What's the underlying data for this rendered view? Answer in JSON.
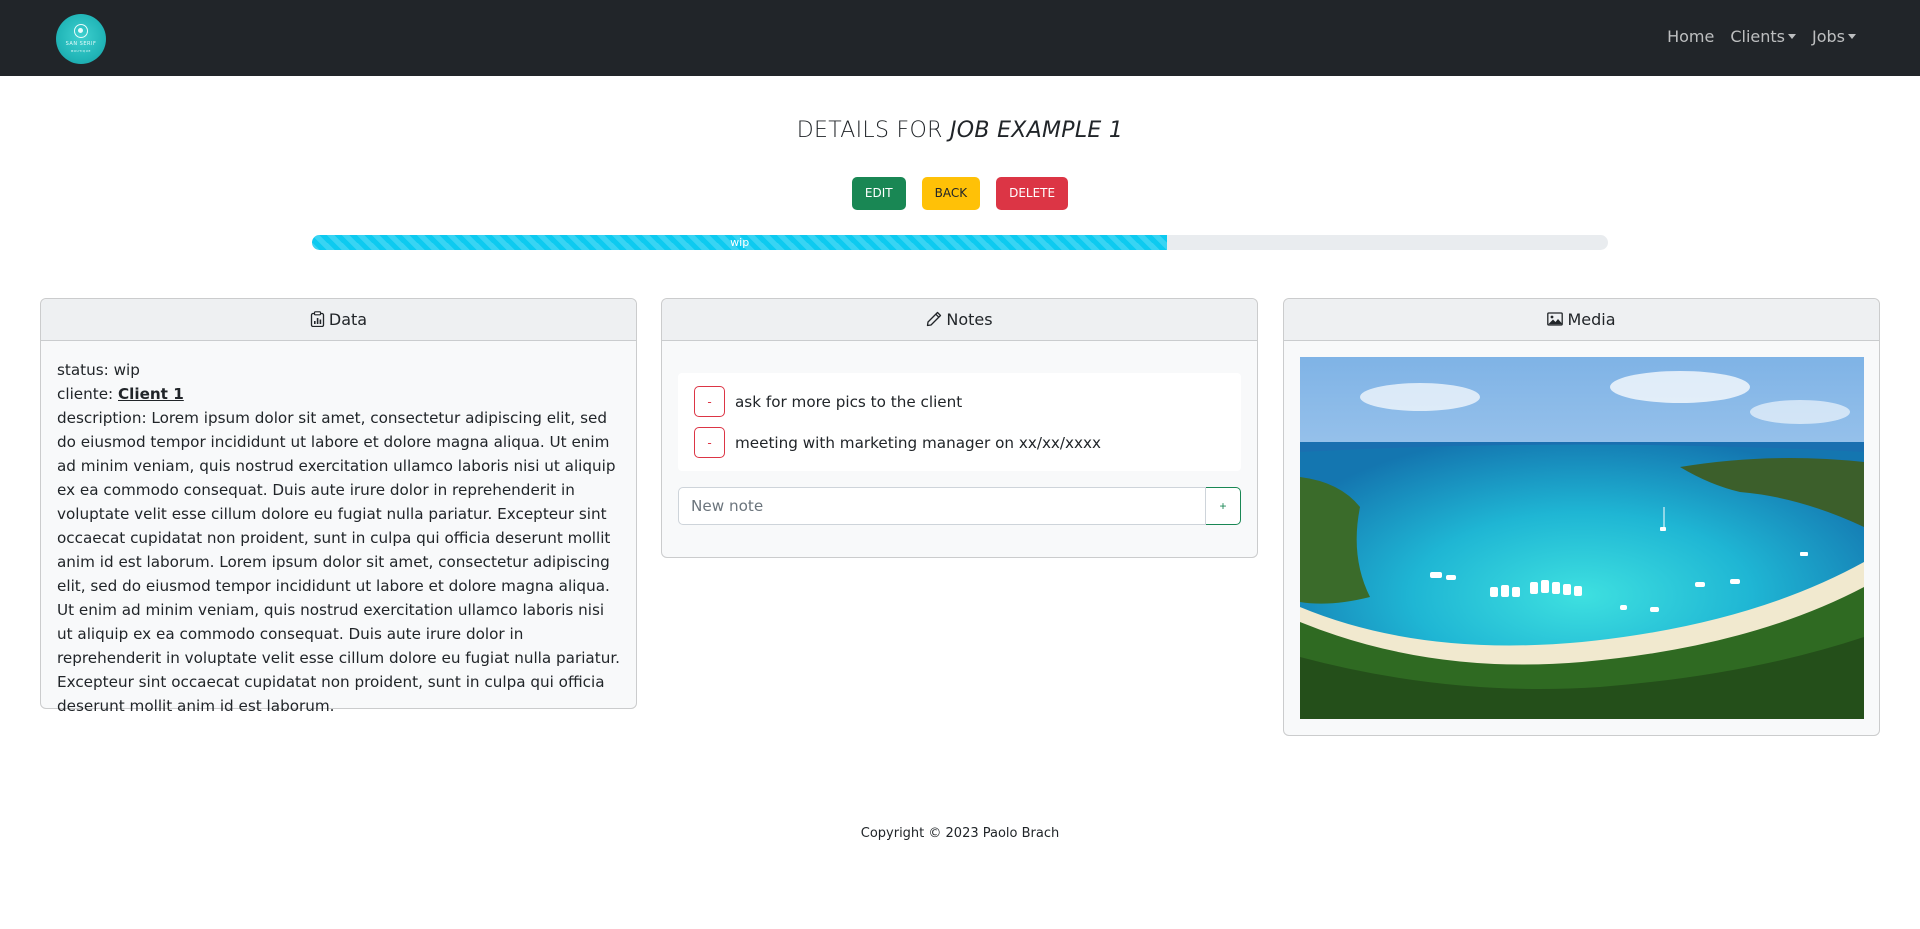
{
  "navbar": {
    "logo_text": "SAN SERIF",
    "logo_sub": "BOUTIQUE",
    "links": [
      {
        "label": "Home"
      },
      {
        "label": "Clients"
      },
      {
        "label": "Jobs"
      }
    ]
  },
  "page": {
    "title_prefix": "DETAILS FOR ",
    "title_job": "JOB EXAMPLE 1"
  },
  "actions": {
    "edit_label": "EDIT",
    "back_label": "BACK",
    "delete_label": "DELETE"
  },
  "progress": {
    "label": "wip",
    "percent": 66
  },
  "data_card": {
    "header": "Data",
    "status_label": "status: ",
    "status_value": "wip",
    "client_label": "cliente: ",
    "client_value": "Client 1",
    "description_label": "description: ",
    "description_value": "Lorem ipsum dolor sit amet, consectetur adipiscing elit, sed do eiusmod tempor incididunt ut labore et dolore magna aliqua. Ut enim ad minim veniam, quis nostrud exercitation ullamco laboris nisi ut aliquip ex ea commodo consequat. Duis aute irure dolor in reprehenderit in voluptate velit esse cillum dolore eu fugiat nulla pariatur. Excepteur sint occaecat cupidatat non proident, sunt in culpa qui officia deserunt mollit anim id est laborum. Lorem ipsum dolor sit amet, consectetur adipiscing elit, sed do eiusmod tempor incididunt ut labore et dolore magna aliqua. Ut enim ad minim veniam, quis nostrud exercitation ullamco laboris nisi ut aliquip ex ea commodo consequat. Duis aute irure dolor in reprehenderit in voluptate velit esse cillum dolore eu fugiat nulla pariatur. Excepteur sint occaecat cupidatat non proident, sunt in culpa qui officia deserunt mollit anim id est laborum."
  },
  "notes_card": {
    "header": "Notes",
    "notes": [
      {
        "delete_label": "-",
        "text": "ask for more pics to the client"
      },
      {
        "delete_label": "-",
        "text": "meeting with marketing manager on xx/xx/xxxx"
      }
    ],
    "input_placeholder": "New note",
    "input_value": "",
    "add_label": "+"
  },
  "media_card": {
    "header": "Media"
  },
  "footer": {
    "copyright": "Copyright © 2023 Paolo Brach"
  },
  "colors": {
    "navbar_bg": "#212529",
    "success": "#198754",
    "warning": "#ffc107",
    "danger": "#dc3545",
    "info": "#0dcaf0"
  },
  "icons": {
    "data": "clipboard-data-icon",
    "notes": "pencil-icon",
    "media": "image-icon"
  }
}
